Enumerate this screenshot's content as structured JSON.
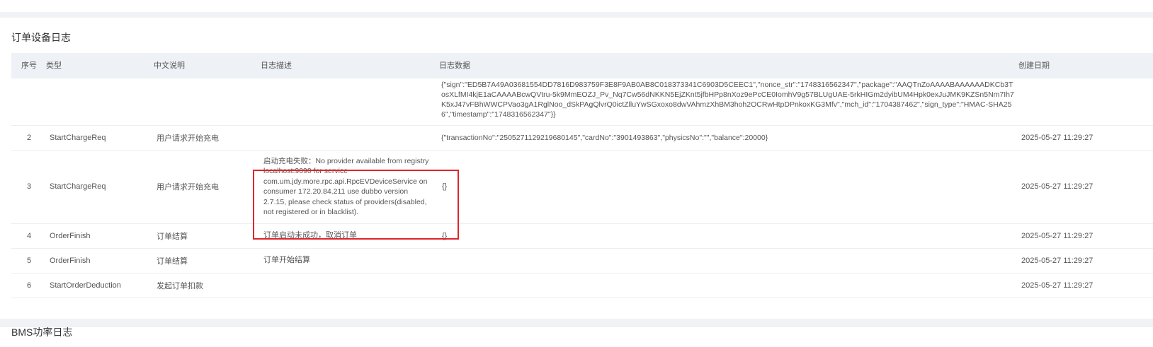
{
  "section_title": "订单设备日志",
  "next_section_title": "BMS功率日志",
  "columns": {
    "index": "序号",
    "type": "类型",
    "cn_desc": "中文说明",
    "log_desc": "日志描述",
    "log_data": "日志数据",
    "created": "创建日期"
  },
  "rows": [
    {
      "index": "",
      "type": "",
      "cn_desc": "",
      "log_desc": "",
      "log_data": "{\"sign\":\"ED5B7A49A03681554DD7816D983759F3E8F9AB0AB8C018373341C6903D5CEEC1\",\"nonce_str\":\"1748316562347\",\"package\":\"AAQTnZoAAAABAAAAAADKCb3TosXLfMI4kjE1aCAAAABcwQVtru-5k9MmEOZJ_Pv_Nq7Cw56dNKKN5EjZKnt5jfbHPp8nXoz9ePcCE0IomhV9g57BLUgUAE-5rkHIGm2dyibUM4Hpk0exJuJMK9KZSn5Nm7Ih7K5xJ47vFBhWWCPVao3gA1RglNoo_dSkPAgQlvrQ0ictZlluYwSGxoxo8dwVAhmzXhBM3hoh2OCRwHtpDPnkoxKG3Mfv\",\"mch_id\":\"1704387462\",\"sign_type\":\"HMAC-SHA256\",\"timestamp\":\"1748316562347\"}}",
      "created": ""
    },
    {
      "index": "2",
      "type": "StartChargeReq",
      "cn_desc": "用户请求开始充电",
      "log_desc": "",
      "log_data": "{\"transactionNo\":\"2505271129219680145\",\"cardNo\":\"3901493863\",\"physicsNo\":\"\",\"balance\":20000}",
      "created": "2025-05-27 11:29:27"
    },
    {
      "index": "3",
      "type": "StartChargeReq",
      "cn_desc": "用户请求开始充电",
      "log_desc": "启动充电失败：No provider available from registry localhost:9090 for service com.um.jdy.more.rpc.api.RpcEVDeviceService on consumer 172.20.84.211 use dubbo version 2.7.15, please check status of providers(disabled, not registered or in blacklist).",
      "log_data": "{}",
      "created": "2025-05-27 11:29:27"
    },
    {
      "index": "4",
      "type": "OrderFinish",
      "cn_desc": "订单结算",
      "log_desc": "订单启动未成功，取消订单",
      "log_data": "{}",
      "created": "2025-05-27 11:29:27"
    },
    {
      "index": "5",
      "type": "OrderFinish",
      "cn_desc": "订单结算",
      "log_desc": "订单开始结算",
      "log_data": "",
      "created": "2025-05-27 11:29:27"
    },
    {
      "index": "6",
      "type": "StartOrderDeduction",
      "cn_desc": "发起订单扣款",
      "log_desc": "",
      "log_data": "",
      "created": "2025-05-27 11:29:27"
    }
  ],
  "highlight_color": "#e0242b",
  "header_bg": "#eef1f6"
}
